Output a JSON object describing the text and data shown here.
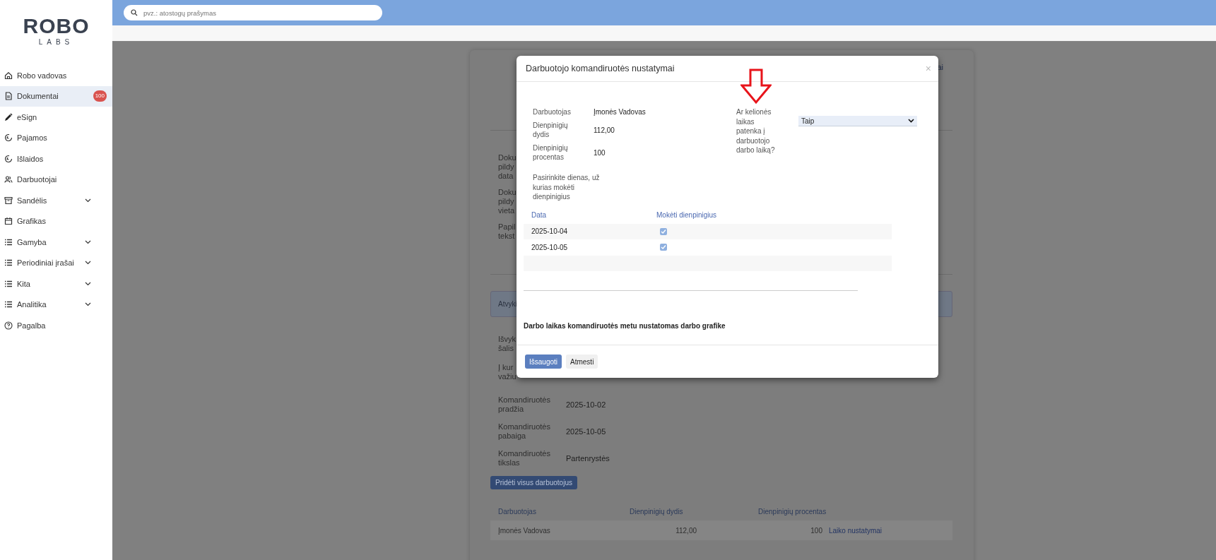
{
  "logo": {
    "top": "ROBO",
    "bottom": "LABS"
  },
  "search": {
    "placeholder": "pvz.: atostogų prašymas"
  },
  "sidebar": {
    "items": [
      {
        "label": "Robo vadovas",
        "kind": "home",
        "selected": false,
        "expandable": false
      },
      {
        "label": "Dokumentai",
        "kind": "document",
        "selected": true,
        "expandable": false,
        "badge": "100"
      },
      {
        "label": "eSign",
        "kind": "pen",
        "selected": false,
        "expandable": false
      },
      {
        "label": "Pajamos",
        "kind": "coin",
        "selected": false,
        "expandable": false
      },
      {
        "label": "Išlaidos",
        "kind": "coin",
        "selected": false,
        "expandable": false
      },
      {
        "label": "Darbuotojai",
        "kind": "people",
        "selected": false,
        "expandable": false
      },
      {
        "label": "Sandėlis",
        "kind": "box",
        "selected": false,
        "expandable": true
      },
      {
        "label": "Grafikas",
        "kind": "calendar",
        "selected": false,
        "expandable": false
      },
      {
        "label": "Gamyba",
        "kind": "list",
        "selected": false,
        "expandable": true
      },
      {
        "label": "Periodiniai įrašai",
        "kind": "list",
        "selected": false,
        "expandable": true
      },
      {
        "label": "Kita",
        "kind": "list",
        "selected": false,
        "expandable": true
      },
      {
        "label": "Analitika",
        "kind": "list",
        "selected": false,
        "expandable": true
      },
      {
        "label": "Pagalba",
        "kind": "help",
        "selected": false,
        "expandable": false
      }
    ]
  },
  "background_page": {
    "corner_fragment": "ai",
    "upper_fragments": [
      [
        "Doku",
        "pildy",
        "data"
      ],
      [
        "Doku",
        "pildy",
        "vieta"
      ],
      [
        "Papil",
        "tekst"
      ]
    ],
    "banner": "Atvyki",
    "middle_fragments": [
      [
        "Išvyk",
        "šalis"
      ],
      [
        "Į kur",
        "važiu"
      ]
    ],
    "details": [
      {
        "label": "Komandiruotės pradžia",
        "value": "2025-10-02"
      },
      {
        "label": "Komandiruotės pabaiga",
        "value": "2025-10-05"
      },
      {
        "label": "Komandiruotės tikslas",
        "value": "Partenrystės"
      }
    ],
    "add_button": "Pridėti visus darbuotojus",
    "table": {
      "columns": [
        "Darbuotojas",
        "Dienpinigių dydis",
        "Dienpinigių procentas"
      ],
      "rows": [
        {
          "employee": "Įmonės Vadovas",
          "amount": "112,00",
          "percent": "100",
          "link": "Laiko nustatymai"
        }
      ]
    }
  },
  "modal": {
    "title": "Darbuotojo komandiruotės nustatymai",
    "close": "×",
    "fields": [
      {
        "label": "Darbuotojas",
        "value": "Įmonės Vadovas"
      },
      {
        "label": "Dienpinigių dydis",
        "value": "112,00"
      },
      {
        "label": "Dienpinigių procentas",
        "value": "100"
      }
    ],
    "question": {
      "label": "Ar kelionės laikas patenka į darbuotojo darbo laiką?",
      "value": "Taip"
    },
    "days_label": "Pasirinkite dienas, už kurias mokėti dienpinigius",
    "table": {
      "columns": [
        "Data",
        "Mokėti dienpinigius"
      ],
      "rows": [
        {
          "date": "2025-10-04",
          "pay": true
        },
        {
          "date": "2025-10-05",
          "pay": true
        }
      ]
    },
    "note": "Darbo laikas komandiruotės metu nustatomas darbo grafike",
    "buttons": [
      {
        "label": "Išsaugoti",
        "kind": "primary"
      },
      {
        "label": "Atmesti",
        "kind": "secondary"
      }
    ]
  }
}
